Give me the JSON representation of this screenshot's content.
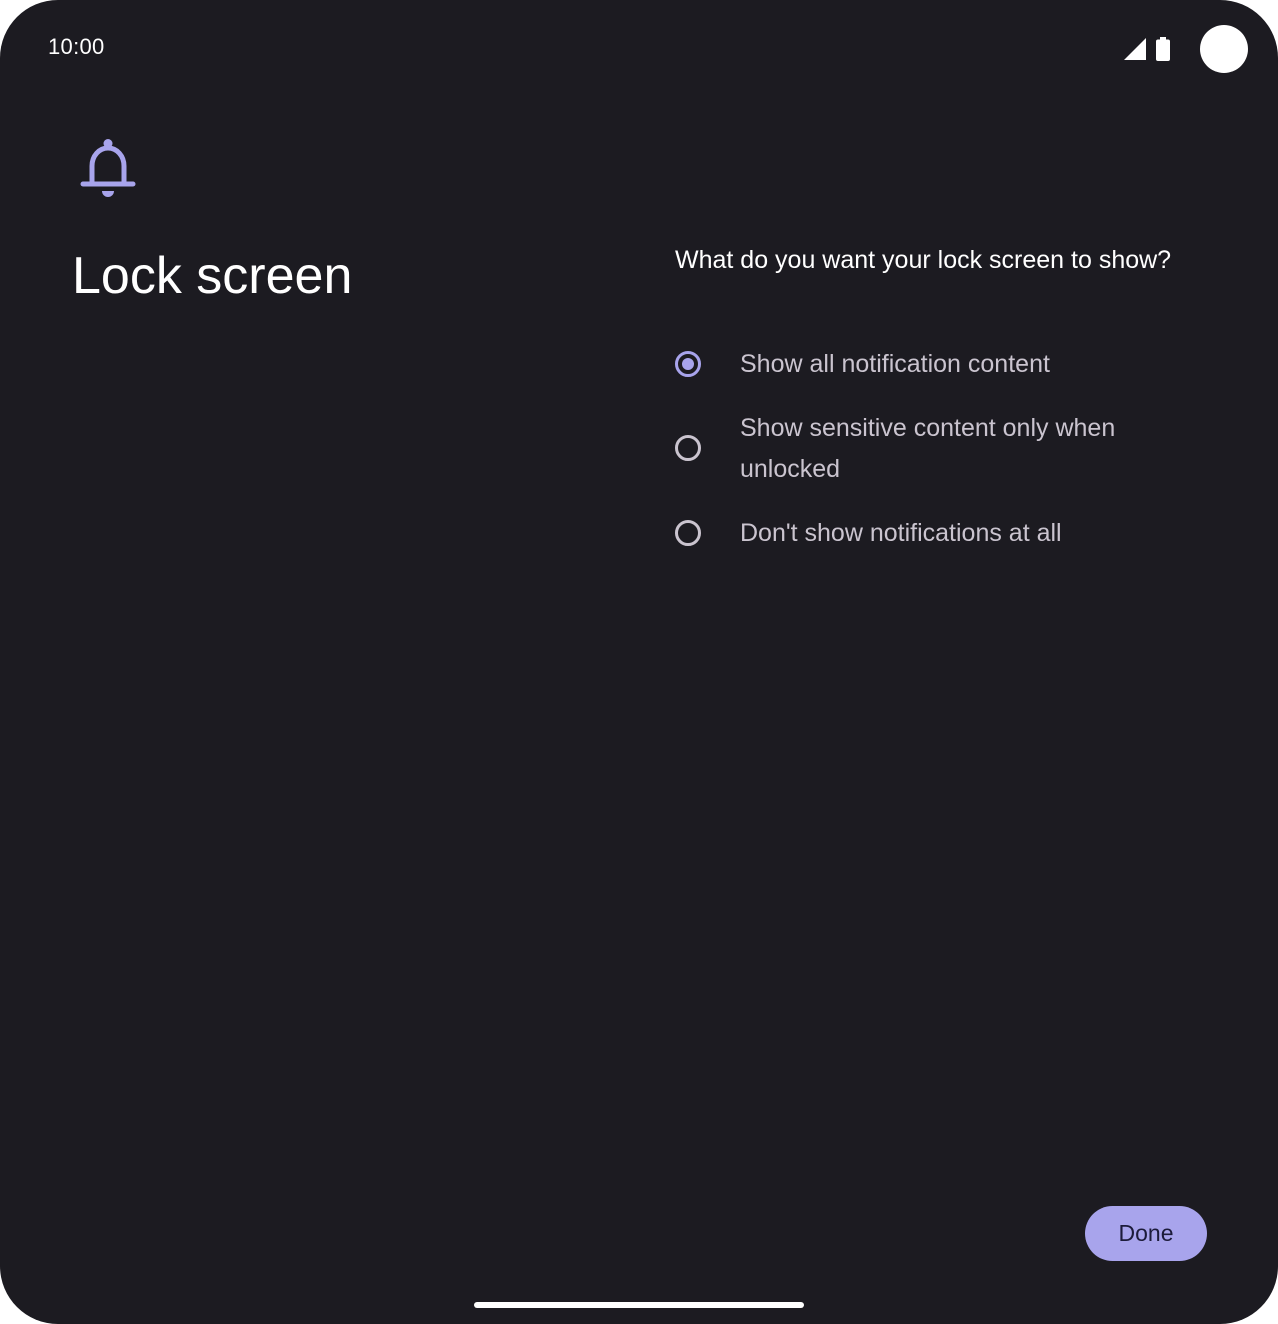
{
  "status_bar": {
    "time": "10:00",
    "icons": [
      "signal-icon",
      "battery-icon"
    ]
  },
  "header": {
    "icon": "bell-icon",
    "title": "Lock screen"
  },
  "content": {
    "question": "What do you want your lock screen to show?",
    "options": [
      {
        "label": "Show all notification content",
        "selected": true
      },
      {
        "label": "Show sensitive content only when unlocked",
        "selected": false
      },
      {
        "label": "Don't show notifications at all",
        "selected": false
      }
    ]
  },
  "footer": {
    "done_label": "Done"
  },
  "colors": {
    "background": "#1c1b21",
    "accent": "#a8a4ec",
    "text_primary": "#ffffff",
    "text_secondary": "#cac4cf"
  }
}
